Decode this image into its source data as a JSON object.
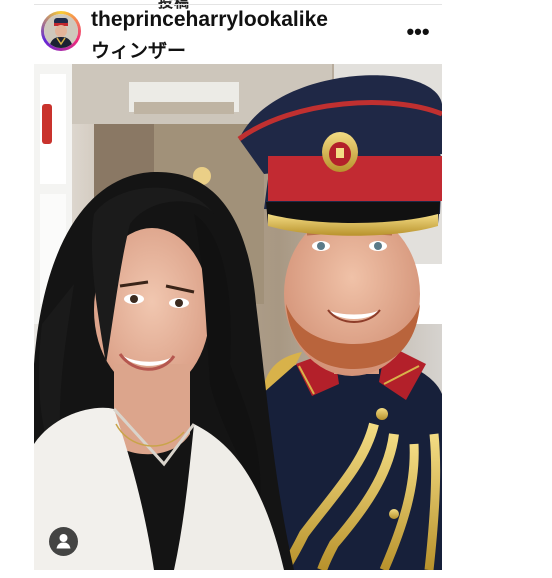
{
  "header_cropped_text": "投稿",
  "post": {
    "username": "theprinceharrylookalike",
    "location": "ウィンザー",
    "more_icon": "more-horizontal-icon",
    "more_label": "•••",
    "avatar_icon": "profile-avatar",
    "tag_icon": "user-tag-icon"
  },
  "colors": {
    "story_ring_start": "#f9ce34",
    "story_ring_mid": "#ee2a7b",
    "story_ring_end": "#6228d7",
    "tag_badge": "#262626"
  }
}
